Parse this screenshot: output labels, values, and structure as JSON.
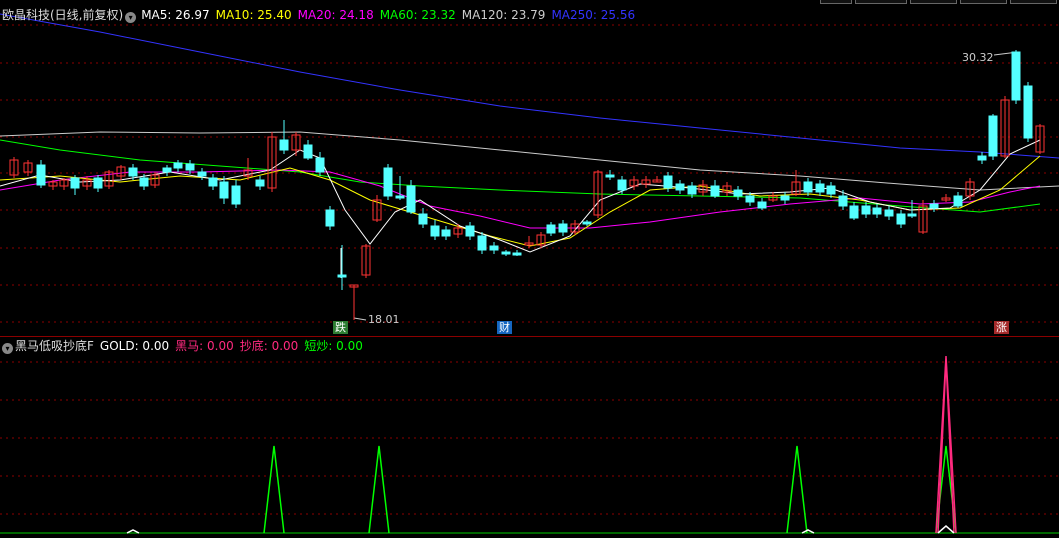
{
  "price_panel": {
    "title": "欧晶科技(日线,前复权)",
    "dropdown_icon": "chevron-down-icon",
    "ma": [
      {
        "label": "MA5:",
        "value": "26.97",
        "color": "#ffffff"
      },
      {
        "label": "MA10:",
        "value": "25.40",
        "color": "#ffff00"
      },
      {
        "label": "MA20:",
        "value": "24.18",
        "color": "#ff00ff"
      },
      {
        "label": "MA60:",
        "value": "23.32",
        "color": "#00ff00"
      },
      {
        "label": "MA120:",
        "value": "23.79",
        "color": "#cccccc"
      },
      {
        "label": "MA250:",
        "value": "25.56",
        "color": "#3333ff"
      }
    ],
    "high_label": "30.32",
    "low_label": "18.01",
    "markers": [
      {
        "text": "跌",
        "bg": "#2e7d32",
        "color": "#ffffff"
      },
      {
        "text": "财",
        "bg": "#1565c0",
        "color": "#ffffff"
      },
      {
        "text": "涨",
        "bg": "#a52a2a",
        "color": "#ffffff"
      }
    ]
  },
  "indicator_panel": {
    "name": "黑马低吸抄底F",
    "dropdown_icon": "chevron-down-icon",
    "values": [
      {
        "label": "GOLD:",
        "value": "0.00",
        "color": "#ffffff"
      },
      {
        "label": "黑马:",
        "value": "0.00",
        "color": "#ff2a7f"
      },
      {
        "label": "抄底:",
        "value": "0.00",
        "color": "#ff2a7f"
      },
      {
        "label": "短炒:",
        "value": "0.00",
        "color": "#00ff00"
      }
    ]
  },
  "colors": {
    "up": "#ff3333",
    "down": "#54ffff",
    "grid": "#8b0000",
    "ma5": "#ffffff",
    "ma10": "#ffff00",
    "ma20": "#ff00ff",
    "ma60": "#00ff00",
    "ma120": "#cccccc",
    "ma250": "#3333ff"
  }
}
